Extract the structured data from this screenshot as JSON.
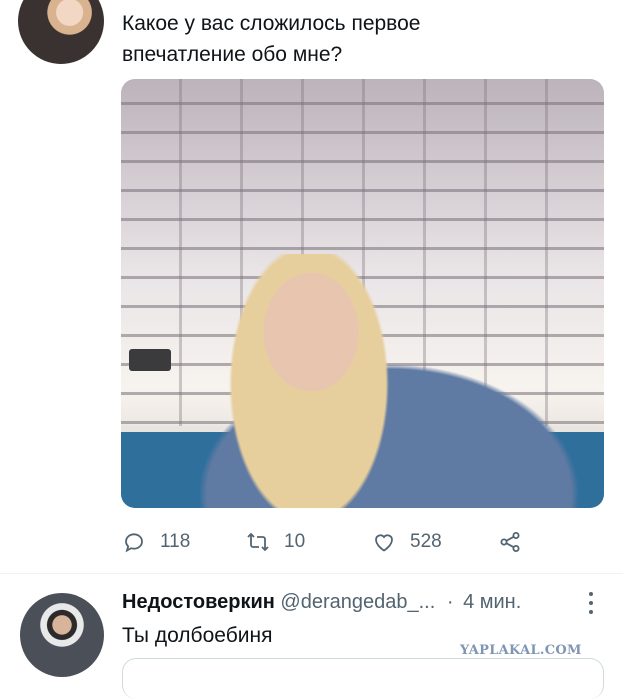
{
  "tweet": {
    "text_line1": "Какое у вас сложилось первое",
    "text_line2": "впечатление обо мне?",
    "stats": {
      "replies": "118",
      "retweets": "10",
      "likes": "528"
    }
  },
  "icons": {
    "reply": "speech-bubble-icon",
    "retweet": "retweet-icon",
    "like": "heart-icon",
    "share": "share-icon",
    "more": "vertical-dots-icon"
  },
  "reply": {
    "name": "Недостоверкин",
    "handle": "@derangedab_...",
    "separator": "·",
    "time": "4 мин.",
    "text": "Ты долбоебиня"
  },
  "watermark": "YAPLAKAL.COM",
  "colors": {
    "text": "#0f1419",
    "secondary": "#536471",
    "divider": "#eff3f4"
  }
}
